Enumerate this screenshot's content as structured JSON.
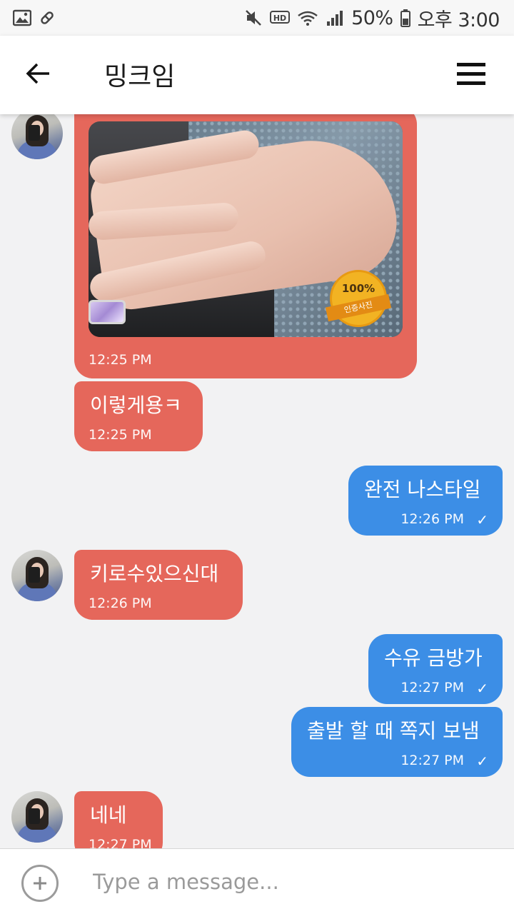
{
  "status_bar": {
    "battery": "50%",
    "time": "오후 3:00"
  },
  "header": {
    "title": "밍크임"
  },
  "messages": [
    {
      "type": "image",
      "direction": "in",
      "time": "12:25 PM",
      "stamp_text": "100%",
      "stamp_sub": "인증사진"
    },
    {
      "direction": "in",
      "text": "이렇게용ㅋ",
      "time": "12:25 PM"
    },
    {
      "direction": "out",
      "text": "완전 나스타일",
      "time": "12:26 PM"
    },
    {
      "direction": "in",
      "text": "키로수있으신대",
      "time": "12:26 PM"
    },
    {
      "direction": "out",
      "text": "수유 금방가",
      "time": "12:27 PM"
    },
    {
      "direction": "out",
      "text": "출발 할 때 쪽지 보냄",
      "time": "12:27 PM"
    },
    {
      "direction": "in",
      "text": "네네",
      "time": "12:27 PM"
    }
  ],
  "check_mark": "✓",
  "composer": {
    "placeholder": "Type a message..."
  },
  "colors": {
    "incoming_bubble": "#e5675b",
    "outgoing_bubble": "#3c8ee6",
    "background": "#f2f2f3"
  }
}
